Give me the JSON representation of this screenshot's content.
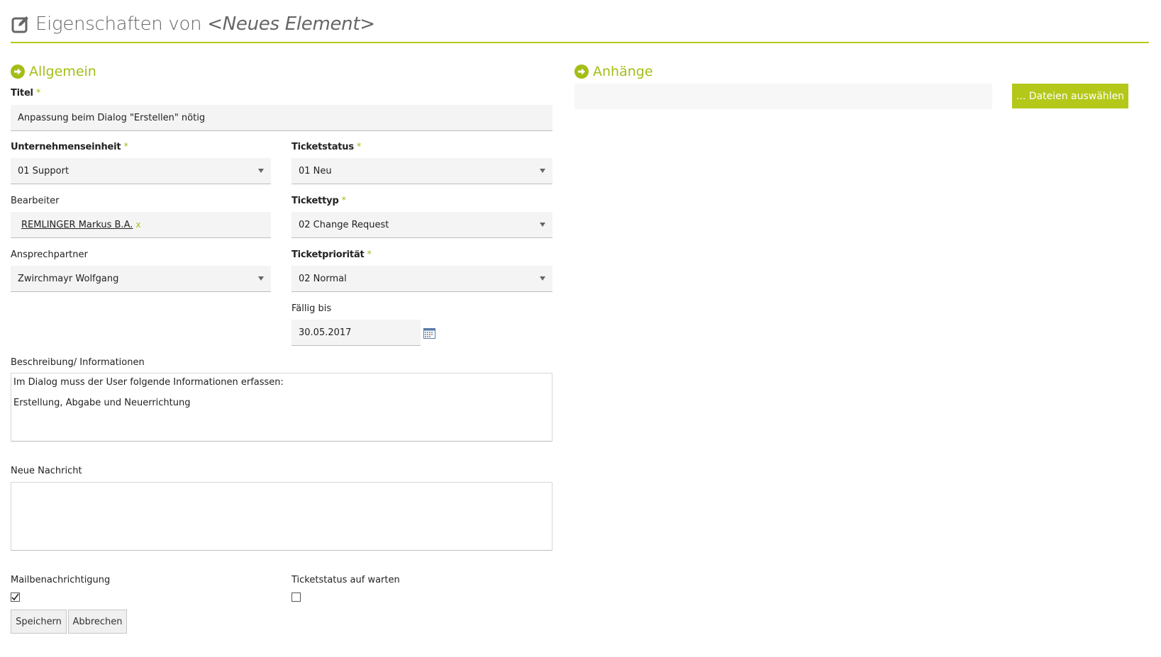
{
  "header": {
    "title_prefix": "Eigenschaften von",
    "item_name": "<Neues Element>"
  },
  "general": {
    "section_title": "Allgemein",
    "titel": {
      "label": "Titel",
      "required": "*",
      "value": "Anpassung beim Dialog \"Erstellen\" nötig"
    },
    "unternehmenseinheit": {
      "label": "Unternehmenseinheit",
      "required": "*",
      "value": "01 Support"
    },
    "ticketstatus": {
      "label": "Ticketstatus",
      "required": "*",
      "value": "01 Neu"
    },
    "bearbeiter": {
      "label": "Bearbeiter",
      "person": "REMLINGER Markus B.A.",
      "remove": "x"
    },
    "tickettyp": {
      "label": "Tickettyp",
      "required": "*",
      "value": "02 Change Request"
    },
    "ansprechpartner": {
      "label": "Ansprechpartner",
      "value": "Zwirchmayr Wolfgang"
    },
    "ticketprioritaet": {
      "label": "Ticketpriorität",
      "required": "*",
      "value": "02 Normal"
    },
    "faellig_bis": {
      "label": "Fällig bis",
      "value": "30.05.2017",
      "icon": "calendar-icon"
    },
    "beschreibung": {
      "label": "Beschreibung/ Informationen",
      "line1": "Im Dialog muss der User folgende Informationen erfassen:",
      "line2": "Erstellung, Abgabe und Neuerrichtung"
    },
    "neue_nachricht": {
      "label": "Neue Nachricht",
      "value": ""
    },
    "mailbenachrichtigung": {
      "label": "Mailbenachrichtigung",
      "checked": true
    },
    "ticketstatus_warten": {
      "label": "Ticketstatus auf warten",
      "checked": false
    }
  },
  "attachments": {
    "section_title": "Anhänge",
    "button_label": "... Dateien auswählen"
  },
  "actions": {
    "save_label": "Speichern",
    "cancel_label": "Abbrechen"
  },
  "colors": {
    "accent": "#b4c81a",
    "accent_text": "#a6bd18",
    "field_bg": "#f4f4f4"
  }
}
